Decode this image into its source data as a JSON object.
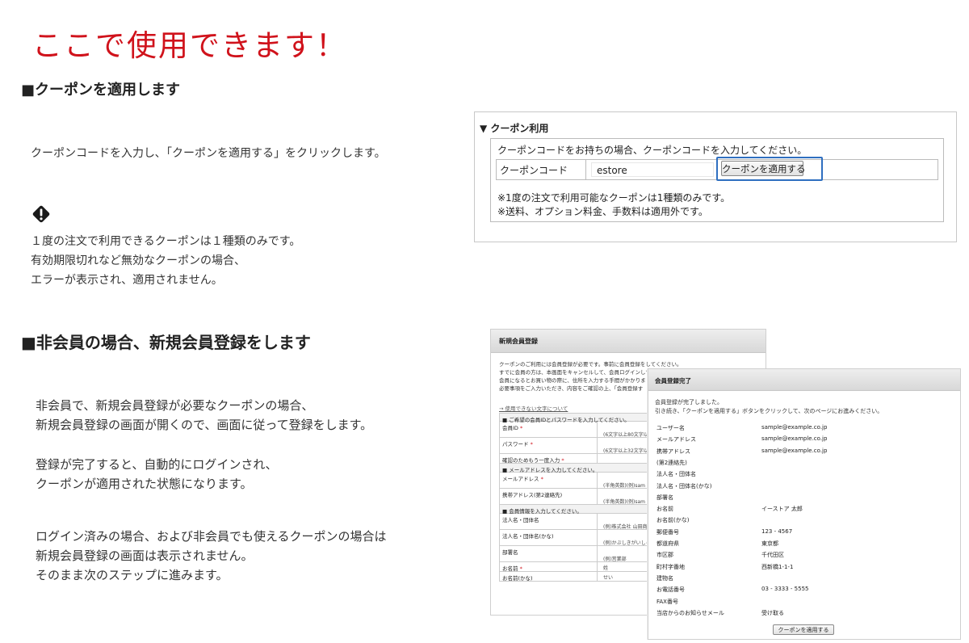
{
  "title": "ここで使用できます！",
  "section1": {
    "heading": "■クーポンを適用します",
    "instruction": "クーポンコードを入力し､「クーポンを適用する」をクリックします。",
    "warning_icon": "diamond-exclamation-icon",
    "warning_lines": [
      "１度の注文で利用できるクーポンは１種類のみです。",
      "有効期限切れなど無効なクーポンの場合、",
      "エラーが表示され、適用されません。"
    ]
  },
  "coupon_panel": {
    "heading": "▼ クーポン利用",
    "intro": "クーポンコードをお持ちの場合、クーポンコードを入力してください。",
    "field_label": "クーポンコード",
    "field_value": "estore",
    "apply_button": "クーポンを適用する",
    "notes": [
      "※1度の注文で利用可能なクーポンは1種類のみです。",
      "※送料、オプション料金、手数料は適用外です。"
    ]
  },
  "section2": {
    "heading": "■非会員の場合、新規会員登録をします",
    "para1": [
      "非会員で、新規会員登録が必要なクーポンの場合、",
      "新規会員登録の画面が開くので、画面に従って登録をします。"
    ],
    "para2": [
      "登録が完了すると、自動的にログインされ、",
      "クーポンが適用された状態になります。"
    ],
    "para3": [
      "ログイン済みの場合、および非会員でも使えるクーポンの場合は",
      "新規会員登録の画面は表示されません。",
      "そのまま次のステップに進みます。"
    ]
  },
  "registration_form": {
    "title": "新規会員登録",
    "intro": [
      "クーポンのご利用には会員登録が必要です。事前に会員登録をしてください。",
      "すでに会員の方は、本画面をキャンセルして、会員ログインして",
      "会員になるとお買い物の際に、住所を入力する手間がかかりま",
      "必要事項をご入力いただき、内容をご確認の上、「会員登録す"
    ],
    "link": "→ 使用できない文字について",
    "rows": [
      {
        "kind": "section",
        "label": "■ ご希望の会員IDとパスワードを入力してください。"
      },
      {
        "kind": "field",
        "label": "会員ID",
        "required": "*",
        "hint": "(6文字以上80文字以"
      },
      {
        "kind": "field",
        "label": "パスワード",
        "required": "*",
        "hint": "(6文字以上32文字以"
      },
      {
        "kind": "short",
        "label": "確認のためもう一度入力",
        "required": "*",
        "hint": ""
      },
      {
        "kind": "section",
        "label": "■ メールアドレスを入力してください。"
      },
      {
        "kind": "field",
        "label": "メールアドレス",
        "required": "*",
        "hint": "(半角英数)(例)sam"
      },
      {
        "kind": "field",
        "label": "携帯アドレス(第2連絡先)",
        "required": "",
        "hint": "(半角英数)(例)sam"
      },
      {
        "kind": "section",
        "label": "■ 会員情報を入力してください。"
      },
      {
        "kind": "field",
        "label": "法人名・団体名",
        "required": "",
        "hint": "(例)株式会社 山田商"
      },
      {
        "kind": "field",
        "label": "法人名・団体名(かな)",
        "required": "",
        "hint": "(例)かぶしきがいしゃ"
      },
      {
        "kind": "field",
        "label": "部署名",
        "required": "",
        "hint": "(例)営業部"
      },
      {
        "kind": "short",
        "label": "お名前",
        "required": "*",
        "hint": "姓"
      },
      {
        "kind": "short",
        "label": "お名前(かな)",
        "required": "",
        "hint": "せい"
      }
    ]
  },
  "completion_panel": {
    "title": "会員登録完了",
    "messages": [
      "会員登録が完了しました。",
      "引き続き、「クーポンを適用する」ボタンをクリックして、次のページにお進みください。"
    ],
    "rows": [
      {
        "label": "ユーザー名",
        "value": "sample@example.co.jp"
      },
      {
        "label": "メールアドレス",
        "value": "sample@example.co.jp"
      },
      {
        "label": "携帯アドレス",
        "value": "sample@example.co.jp"
      },
      {
        "label": "(第2連絡先)",
        "value": ""
      },
      {
        "label": "法人名・団体名",
        "value": ""
      },
      {
        "label": "法人名・団体名(かな)",
        "value": ""
      },
      {
        "label": "部署名",
        "value": ""
      },
      {
        "label": "お名前",
        "value": "イーストア 太郎"
      },
      {
        "label": "お名前(かな)",
        "value": ""
      },
      {
        "label": "郵便番号",
        "value": "123 - 4567"
      },
      {
        "label": "都道府県",
        "value": "東京都"
      },
      {
        "label": "市区郡",
        "value": "千代田区"
      },
      {
        "label": "町村字番地",
        "value": "西新橋1-1-1"
      },
      {
        "label": "建物名",
        "value": ""
      },
      {
        "label": "お電話番号",
        "value": "03 - 3333 - 5555"
      },
      {
        "label": "FAX番号",
        "value": ""
      },
      {
        "label": "当店からのお知らせメール",
        "value": "受け取る"
      }
    ],
    "button": "クーポンを適用する"
  },
  "colors": {
    "title_red": "#d0121b",
    "button_highlight_blue": "#2f6fc0"
  }
}
